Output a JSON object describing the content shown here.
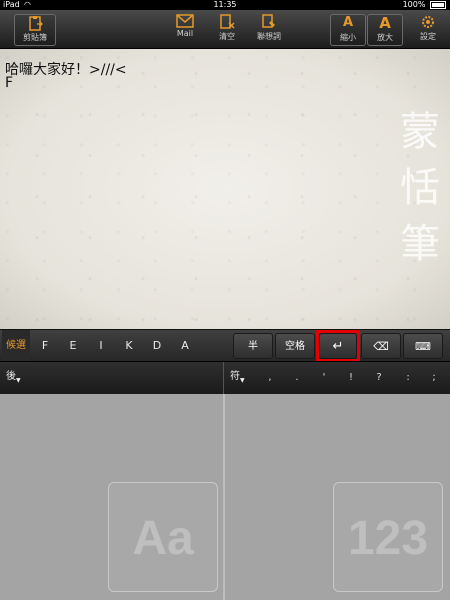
{
  "status_bar": {
    "carrier": "iPad",
    "time": "11:35",
    "battery": "100%"
  },
  "toolbar": {
    "clipboard_label": "剪貼簿",
    "mail_label": "Mail",
    "clear_label": "清空",
    "phrase_label": "聯想詞",
    "shrink_label": "縮小",
    "enlarge_label": "放大",
    "settings_label": "設定",
    "font_glyph": "A"
  },
  "editor": {
    "lines": [
      "哈囉大家好！>///<",
      "F"
    ],
    "watermark": [
      "蒙",
      "恬",
      "筆"
    ]
  },
  "candidates": {
    "label": "候選",
    "items": [
      "F",
      "E",
      "I",
      "K",
      "D",
      "A"
    ],
    "half_label": "半",
    "space_label": "空格",
    "enter_symbol": "↵",
    "backspace_symbol": "⌫",
    "keyboard_symbol": "⌨"
  },
  "punctuation": {
    "left_label": "後",
    "right_label": "符",
    "items": [
      ",",
      ".",
      "'",
      "!",
      "?",
      ":",
      ";"
    ]
  },
  "pads": {
    "left_mode": "Aa",
    "right_mode": "123"
  }
}
